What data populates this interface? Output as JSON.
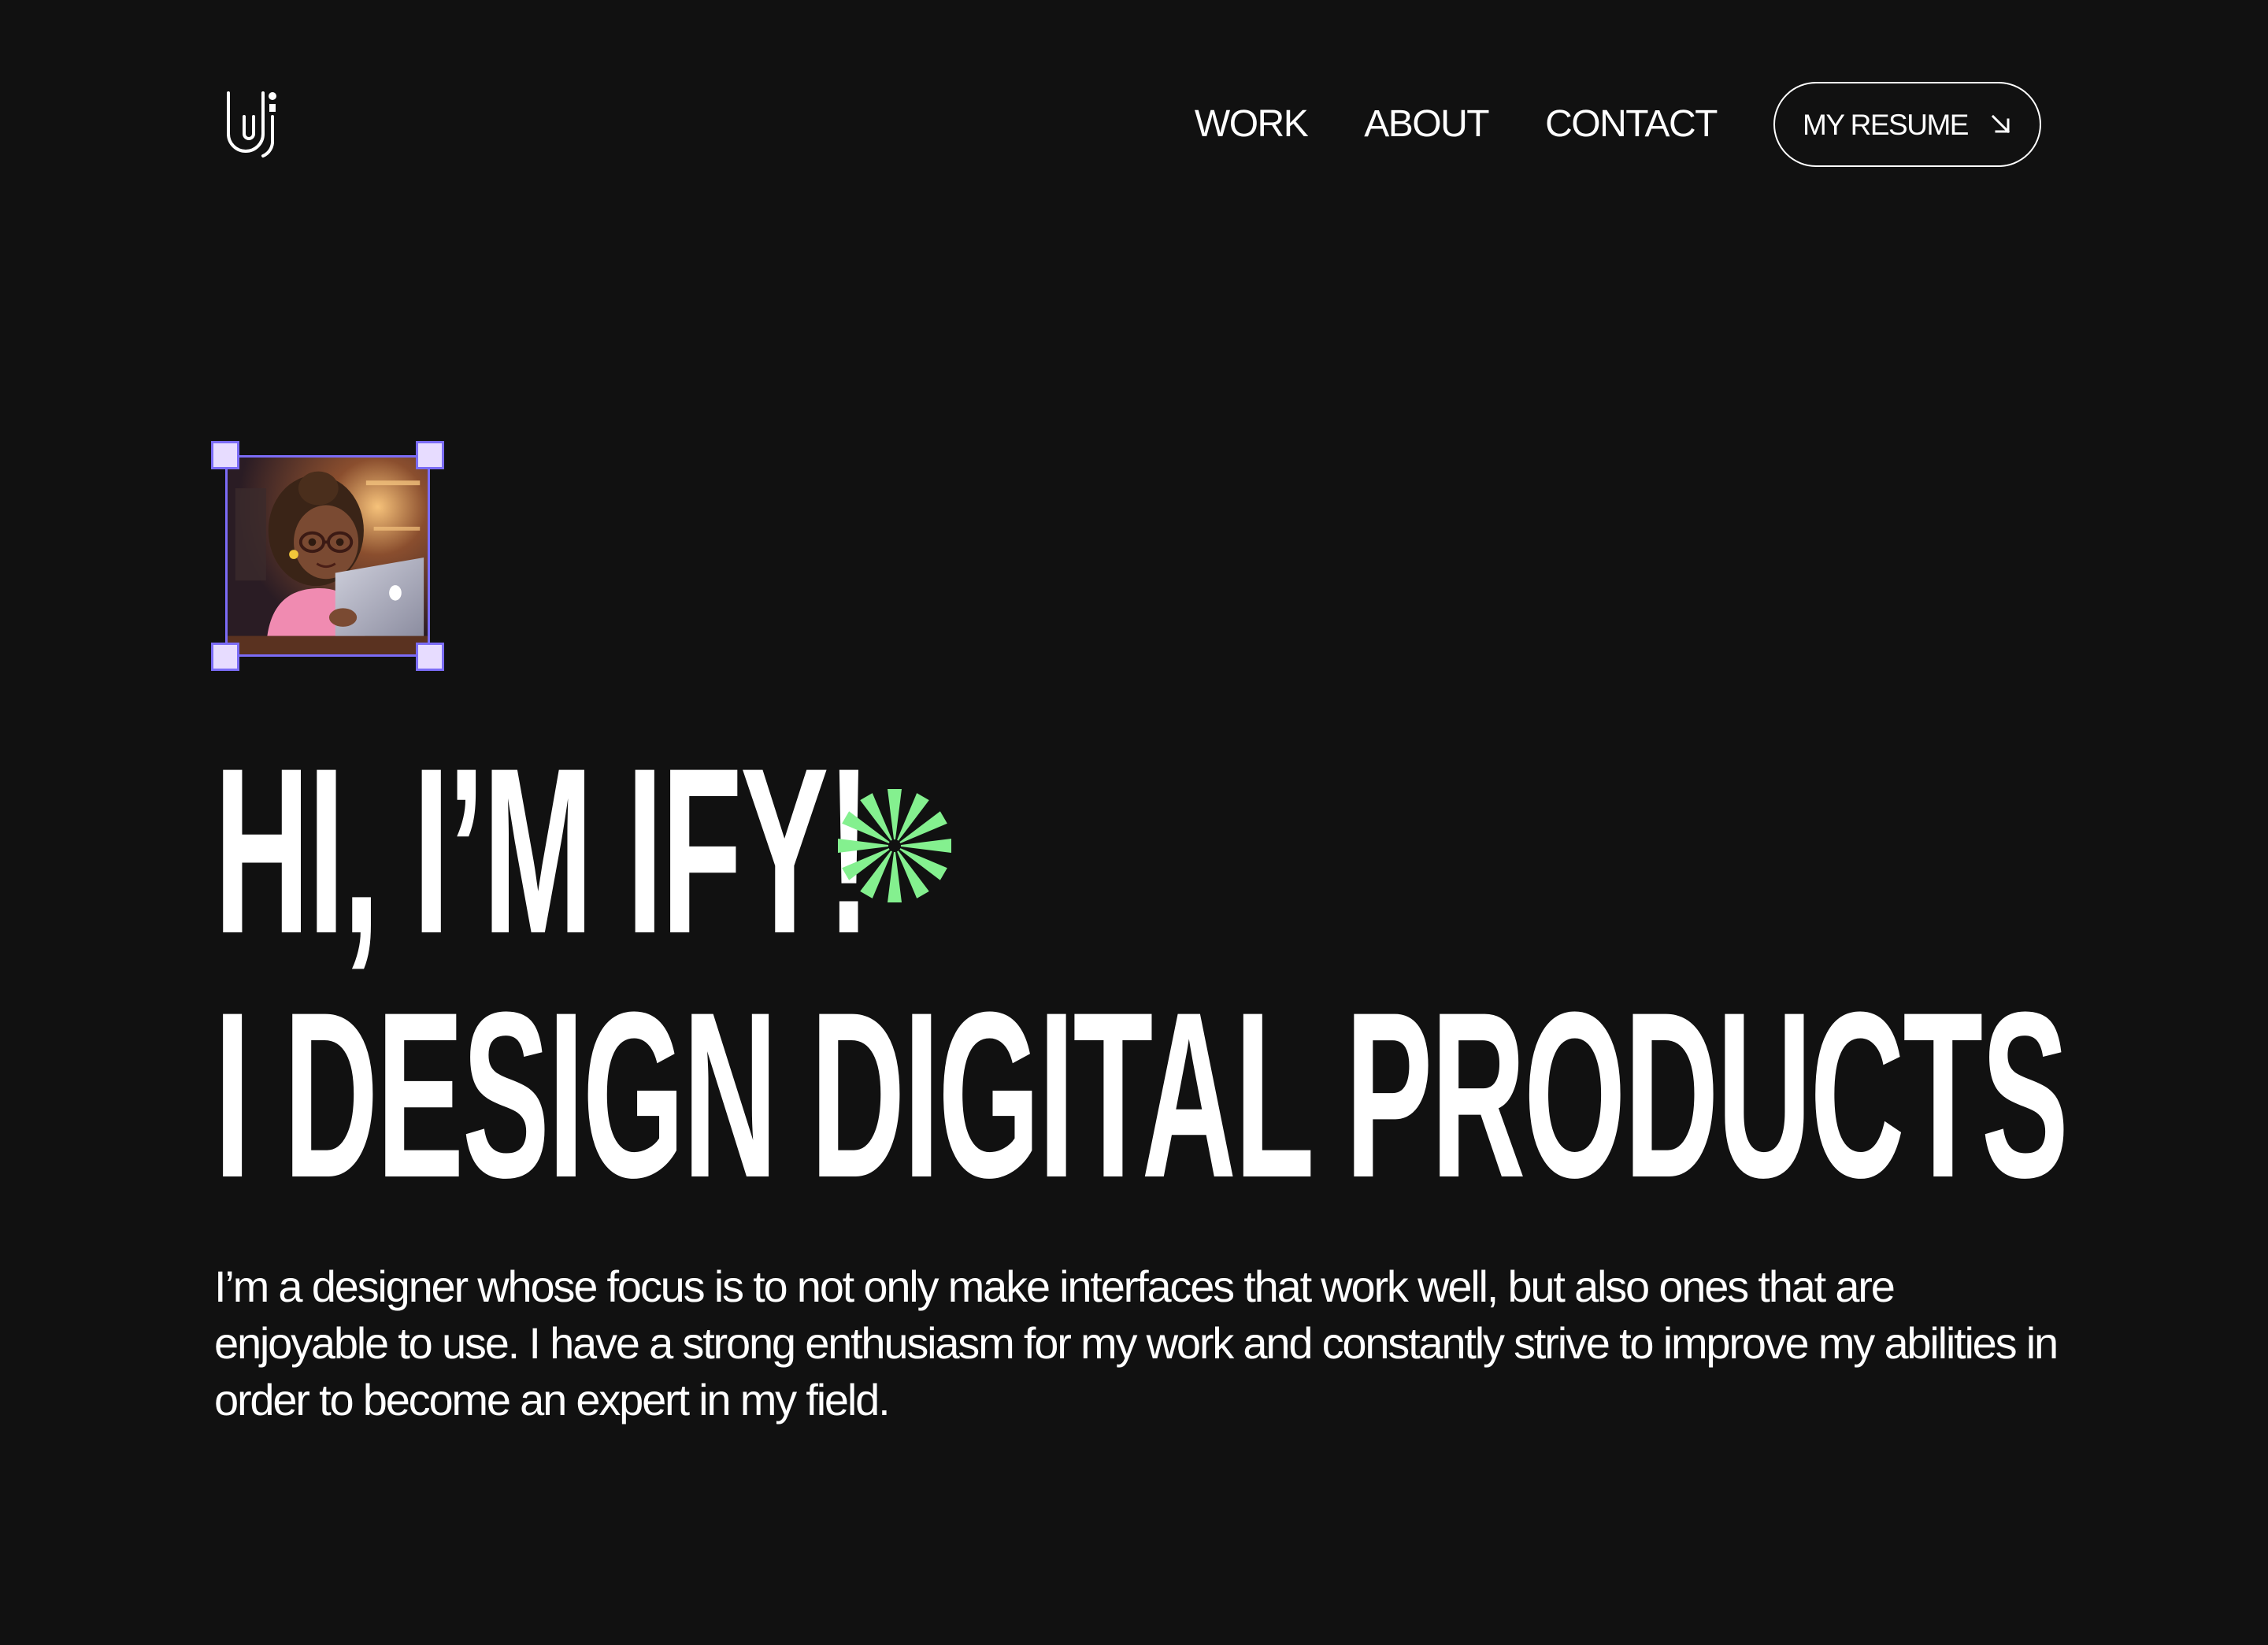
{
  "header": {
    "logo_icon": "ui-monogram-logo",
    "nav": [
      {
        "label": "WORK"
      },
      {
        "label": "ABOUT"
      },
      {
        "label": "CONTACT"
      }
    ],
    "resume_button": {
      "label": "MY RESUME",
      "icon": "arrow-down-right-icon"
    }
  },
  "hero": {
    "avatar_icon": "3d-avatar-woman-with-laptop",
    "selection_color": "#7b6cf6",
    "greeting": "HI, I’M IFY!",
    "sparkle_icon": "sparkle-asterisk-icon",
    "sparkle_color": "#84f08f",
    "headline": "I DESIGN DIGITAL PRODUCTS",
    "intro": "I’m a designer whose focus is to not only make interfaces that work well, but also ones that are enjoyable to use. I have a strong enthusiasm for my work and constantly strive to improve my abilities in order to become an expert in my field."
  },
  "colors": {
    "background": "#111111",
    "text": "#ffffff"
  }
}
